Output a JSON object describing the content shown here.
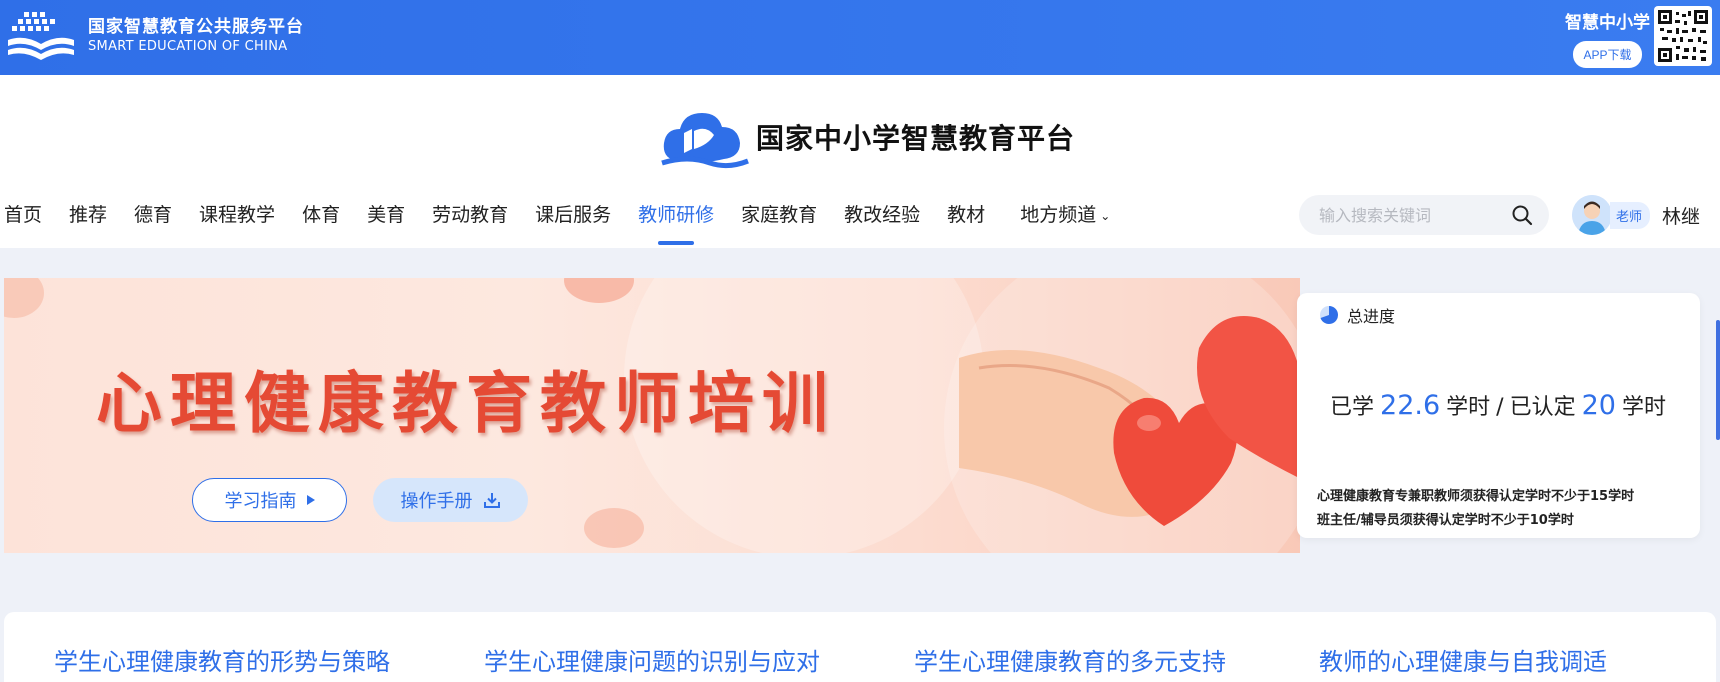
{
  "topbar": {
    "brand_cn": "国家智慧教育公共服务平台",
    "brand_en": "SMART EDUCATION OF CHINA",
    "app_title": "智慧中小学",
    "app_button": "APP下载"
  },
  "header": {
    "platform_title": "国家中小学智慧教育平台"
  },
  "nav": {
    "items": [
      "首页",
      "推荐",
      "德育",
      "课程教学",
      "体育",
      "美育",
      "劳动教育",
      "课后服务",
      "教师研修",
      "家庭教育",
      "教改经验",
      "教材",
      "地方频道"
    ],
    "active_index": 8
  },
  "search": {
    "placeholder": "输入搜索关键词"
  },
  "user": {
    "role": "老师",
    "name": "林继"
  },
  "banner": {
    "title": "心理健康教育教师培训",
    "guide_button": "学习指南",
    "manual_button": "操作手册"
  },
  "progress": {
    "heading": "总进度",
    "learned_prefix": "已学",
    "learned_value": "22.6",
    "unit": "学时",
    "separator": "/",
    "certified_prefix": "已认定",
    "certified_value": "20",
    "note_1": "心理健康教育专兼职教师须获得认定学时不少于15学时",
    "note_2": "班主任/辅导员须获得认定学时不少于10学时"
  },
  "courses": {
    "tabs": [
      "学生心理健康教育的形势与策略",
      "学生心理健康问题的识别与应对",
      "学生心理健康教育的多元支持",
      "教师的心理健康与自我调适"
    ]
  },
  "colors": {
    "primary": "#2f6fe8",
    "banner_title": "#e54a34"
  }
}
